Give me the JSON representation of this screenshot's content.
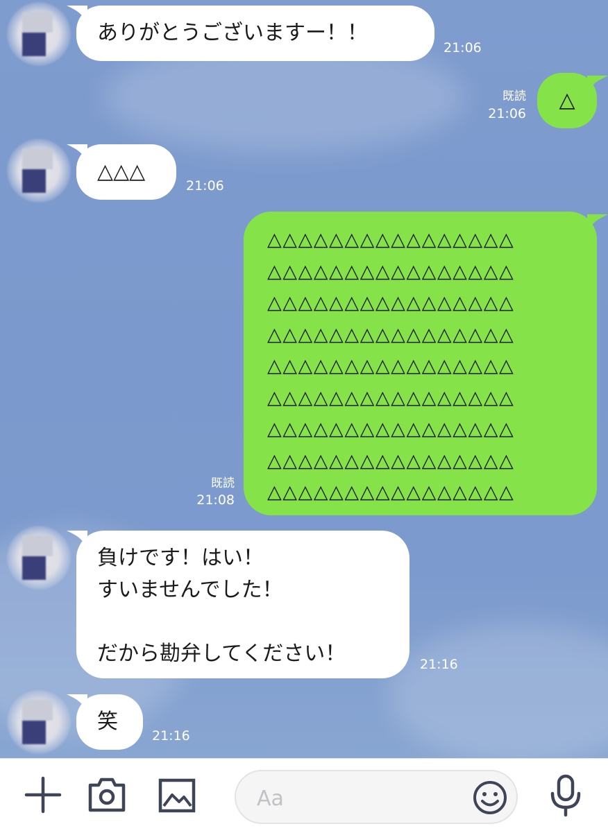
{
  "chat": {
    "messages": [
      {
        "side": "in",
        "text": "ありがとうございますー！！",
        "time": "21:06"
      },
      {
        "side": "out",
        "text": "△",
        "time": "21:06",
        "read": "既読"
      },
      {
        "side": "in",
        "text": "△△△",
        "time": "21:06"
      },
      {
        "side": "out",
        "rows": [
          "△△△△△△△△△△△△△△△△",
          "△△△△△△△△△△△△△△△△",
          "△△△△△△△△△△△△△△△△",
          "△△△△△△△△△△△△△△△△",
          "△△△△△△△△△△△△△△△△",
          "△△△△△△△△△△△△△△△△",
          "△△△△△△△△△△△△△△△△",
          "△△△△△△△△△△△△△△△△",
          "△△△△△△△△△△△△△△△△"
        ],
        "time": "21:08",
        "read": "既読"
      },
      {
        "side": "in",
        "text": "負けです！はい！\nすいませんでした！\n\nだから勘弁してください！",
        "time": "21:16"
      },
      {
        "side": "in",
        "text": "笑",
        "time": "21:16"
      }
    ]
  },
  "composer": {
    "placeholder": "Aa",
    "icons": [
      "plus-icon",
      "camera-icon",
      "image-icon",
      "emoji-icon",
      "microphone-icon"
    ]
  },
  "colors": {
    "background": "#7f9ccf",
    "outgoing_bubble": "#85e249",
    "incoming_bubble": "#ffffff",
    "icon": "#3e4556"
  }
}
